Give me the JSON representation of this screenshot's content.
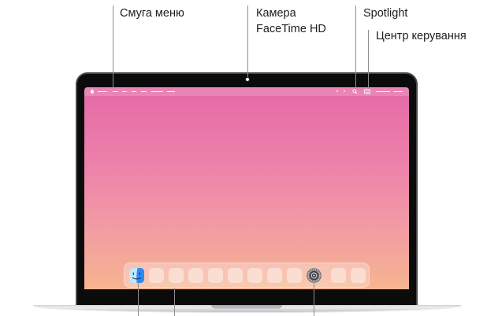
{
  "callouts": {
    "menu_bar": "Смуга меню",
    "camera": [
      "Камера",
      "FaceTime HD"
    ],
    "spotlight": "Spotlight",
    "control_center": "Центр керування"
  },
  "laptop": {
    "camera_icon": "camera-icon",
    "screen": {
      "wallpaper_colors": [
        "#e46aa7",
        "#ec7eaa",
        "#f199a6",
        "#f6b58f"
      ],
      "menu_bar": {
        "left_icons": [
          "apple-icon"
        ],
        "right_icons": [
          "search-icon",
          "control-center-icon"
        ]
      },
      "dock": {
        "app_icons": [
          "finder-icon",
          "app-placeholder-icon",
          "app-placeholder-icon",
          "app-placeholder-icon",
          "app-placeholder-icon",
          "app-placeholder-icon",
          "app-placeholder-icon",
          "app-placeholder-icon",
          "app-placeholder-icon",
          "system-settings-icon"
        ],
        "extra_icons": [
          "app-placeholder-icon",
          "app-placeholder-icon"
        ]
      }
    }
  },
  "colors": {
    "label_text": "#1d1d1f",
    "leader_line": "#8e8e93",
    "bezel": "#0b0b0c",
    "aluminum": "#d9d9dc"
  }
}
